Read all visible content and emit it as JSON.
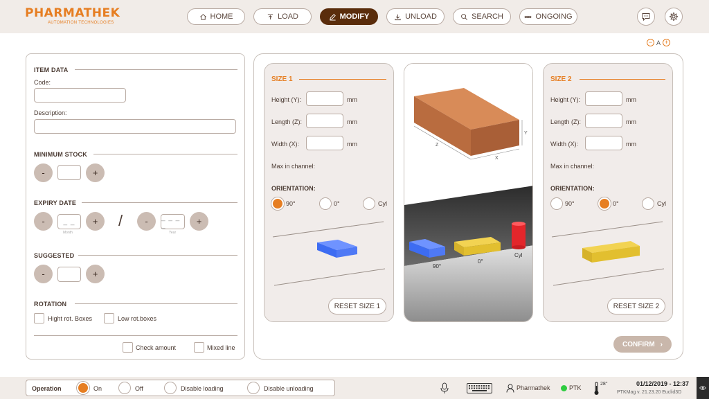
{
  "header": {
    "brand": "PHARMATHEK",
    "tagline": "AUTOMATION TECHNOLOGIES",
    "nav": [
      {
        "label": "HOME",
        "icon": "home-icon"
      },
      {
        "label": "LOAD",
        "icon": "load-icon"
      },
      {
        "label": "MODIFY",
        "icon": "edit-icon",
        "active": true
      },
      {
        "label": "UNLOAD",
        "icon": "unload-icon"
      },
      {
        "label": "SEARCH",
        "icon": "search-icon"
      },
      {
        "label": "ONGOING",
        "icon": "ongoing-icon"
      }
    ]
  },
  "font_control": {
    "minus": "−",
    "label": "A",
    "plus": "+"
  },
  "item_data": {
    "title": "ITEM DATA",
    "code_label": "Code:",
    "code_value": "",
    "description_label": "Description:",
    "description_value": ""
  },
  "minimum_stock": {
    "title": "MINIMUM STOCK",
    "minus": "-",
    "plus": "+",
    "value": ""
  },
  "expiry_date": {
    "title": "EXPIRY DATE",
    "minus": "-",
    "plus": "+",
    "month_placeholder": "_ _",
    "month_label": "Month",
    "separator": "/",
    "year_placeholder": "_ _ _ _",
    "year_label": "Year"
  },
  "suggested": {
    "title": "SUGGESTED",
    "minus": "-",
    "plus": "+",
    "value": ""
  },
  "rotation": {
    "title": "ROTATION",
    "high_rot": "Hight rot. Boxes",
    "low_rot": "Low rot.boxes",
    "check_amount": "Check amount",
    "mixed_line": "Mixed line"
  },
  "size1": {
    "title": "SIZE 1",
    "height_label": "Height (Y):",
    "length_label": "Length (Z):",
    "width_label": "Width (X):",
    "unit": "mm",
    "max_label": "Max in channel:",
    "orientation_title": "ORIENTATION:",
    "options": [
      "90°",
      "0°",
      "Cyl"
    ],
    "selected": "90°",
    "reset": "RESET SIZE 1"
  },
  "size2": {
    "title": "SIZE 2",
    "height_label": "Height (Y):",
    "length_label": "Length (Z):",
    "width_label": "Width (X):",
    "unit": "mm",
    "max_label": "Max in channel:",
    "orientation_title": "ORIENTATION:",
    "options": [
      "90°",
      "0°",
      "Cyl"
    ],
    "selected": "0°",
    "reset": "RESET SIZE 2"
  },
  "preview": {
    "axis_z": "Z",
    "axis_x": "X",
    "axis_y": "Y",
    "labels": [
      "90°",
      "0°",
      "Cyl"
    ]
  },
  "confirm_label": "CONFIRM",
  "footer": {
    "operation_label": "Operation",
    "options": [
      "On",
      "Off",
      "Disable loading",
      "Disable unloading"
    ],
    "selected": "On",
    "user": "Pharmathek",
    "status": "PTK",
    "status_color": "#2ecc40",
    "temperature": "28°",
    "datetime": "01/12/2019 - 12:37",
    "version": "PTKMag v. 21.23.20 Euclid3D"
  },
  "colors": {
    "accent": "#e67e22",
    "active_nav": "#5a2d0c",
    "box_brown": "#c97a4a",
    "blue": "#3b6df0",
    "yellow": "#e6c232",
    "red": "#e3262b"
  }
}
